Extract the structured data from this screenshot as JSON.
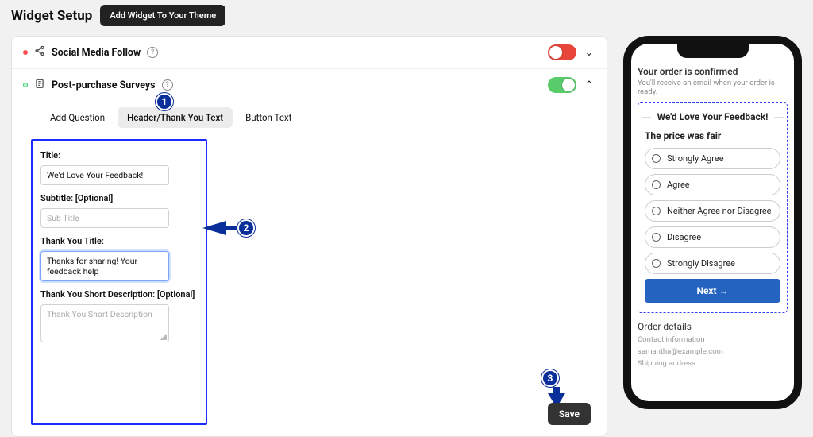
{
  "header": {
    "title": "Widget Setup",
    "theme_button": "Add Widget To Your Theme"
  },
  "sections": {
    "social": {
      "title": "Social Media Follow",
      "enabled": false
    },
    "survey": {
      "title": "Post-purchase Surveys",
      "enabled": true,
      "tabs": {
        "add_question": "Add Question",
        "header_text": "Header/Thank You Text",
        "button_text": "Button Text"
      },
      "form": {
        "title_label": "Title:",
        "title_value": "We'd Love Your Feedback!",
        "subtitle_label": "Subtitle: [Optional]",
        "subtitle_placeholder": "Sub Title",
        "thank_title_label": "Thank You Title:",
        "thank_title_value": "Thanks for sharing! Your feedback help",
        "thank_desc_label": "Thank You Short Description: [Optional]",
        "thank_desc_placeholder": "Thank You Short Description"
      },
      "save": "Save"
    }
  },
  "annotations": {
    "b1": "1",
    "b2": "2",
    "b3": "3"
  },
  "preview": {
    "confirm_title": "Your order is confirmed",
    "confirm_sub": "You'll receive an email when your order is ready.",
    "survey_title": "We'd Love Your Feedback!",
    "question": "The price was fair",
    "options": [
      "Strongly Agree",
      "Agree",
      "Neither Agree nor Disagree",
      "Disagree",
      "Strongly Disagree"
    ],
    "next": "Next →",
    "order_details_header": "Order details",
    "contact_info": "Contact information",
    "email": "samantha@example.com",
    "shipping": "Shipping address"
  }
}
